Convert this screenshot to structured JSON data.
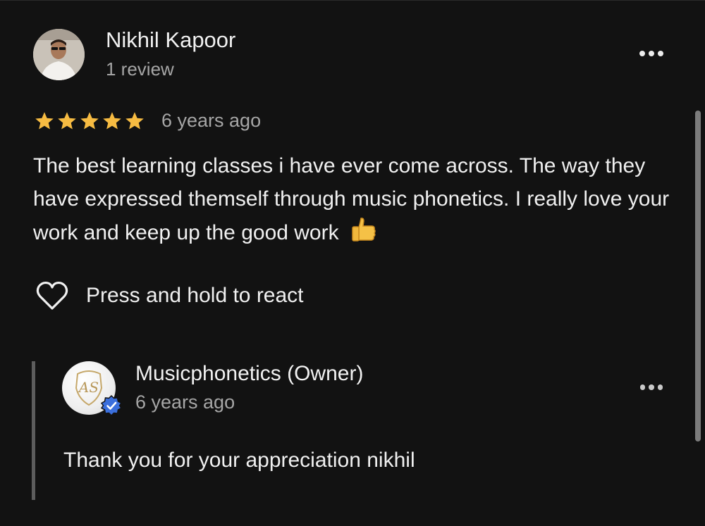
{
  "review": {
    "author_name": "Nikhil Kapoor",
    "author_meta": "1 review",
    "rating": 5,
    "rating_max": 5,
    "date": "6 years ago",
    "text": "The best learning classes i have ever come across. The way they have expressed themself through music phonetics. I really love your work and keep up the good work",
    "text_emoji": "👍"
  },
  "react": {
    "label": "Press and hold to react"
  },
  "owner_reply": {
    "name": "Musicphonetics (Owner)",
    "date": "6 years ago",
    "text": "Thank you for your appreciation nikhil",
    "logo_text": "AS"
  },
  "colors": {
    "background": "#121212",
    "star": "#f6bb42",
    "verified_badge": "#3b6fdc",
    "secondary_text": "#a6a6a6"
  },
  "icons": {
    "more": "more-horizontal-icon",
    "star": "star-icon",
    "heart": "heart-outline-icon",
    "verified": "verified-check-icon"
  }
}
